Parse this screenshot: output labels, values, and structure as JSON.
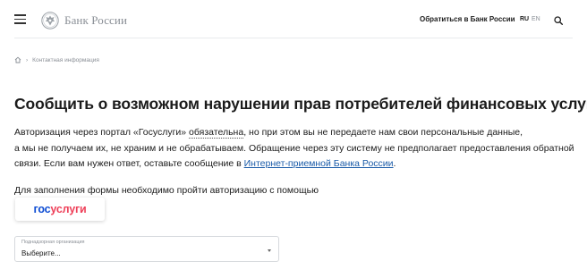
{
  "header": {
    "logo_text": "Банк России",
    "contact_link": "Обратиться в Банк России",
    "lang_ru": "RU",
    "lang_en": "EN"
  },
  "breadcrumb": {
    "current": "Контактная информация"
  },
  "page_title": "Сообщить о возможном нарушении прав потребителей финансовых услуг",
  "intro": {
    "line1_pre": "Авторизация через портал «Госуслуги» ",
    "line1_dotted": "обязательна",
    "line1_post": ", но при этом вы не передаете нам свои персональные данные,",
    "line2": "а мы не получаем их, не храним и не обрабатываем. Обращение через эту систему не предполагает предоставления обратной",
    "line3_pre": "связи. Если вам нужен ответ, оставьте сообщение в ",
    "line3_link": "Интернет-приемной Банка России",
    "line3_post": "."
  },
  "auth_note": "Для заполнения формы необходимо пройти авторизацию с помощью",
  "gosuslugi": {
    "part1": "гос",
    "part2": "услуги"
  },
  "org_select": {
    "label": "Поднадзорная организация",
    "value": "Выберите..."
  },
  "colors": {
    "link": "#1a5ba8",
    "gos_blue": "#0d4cd3",
    "gos_red": "#ee3f58"
  }
}
